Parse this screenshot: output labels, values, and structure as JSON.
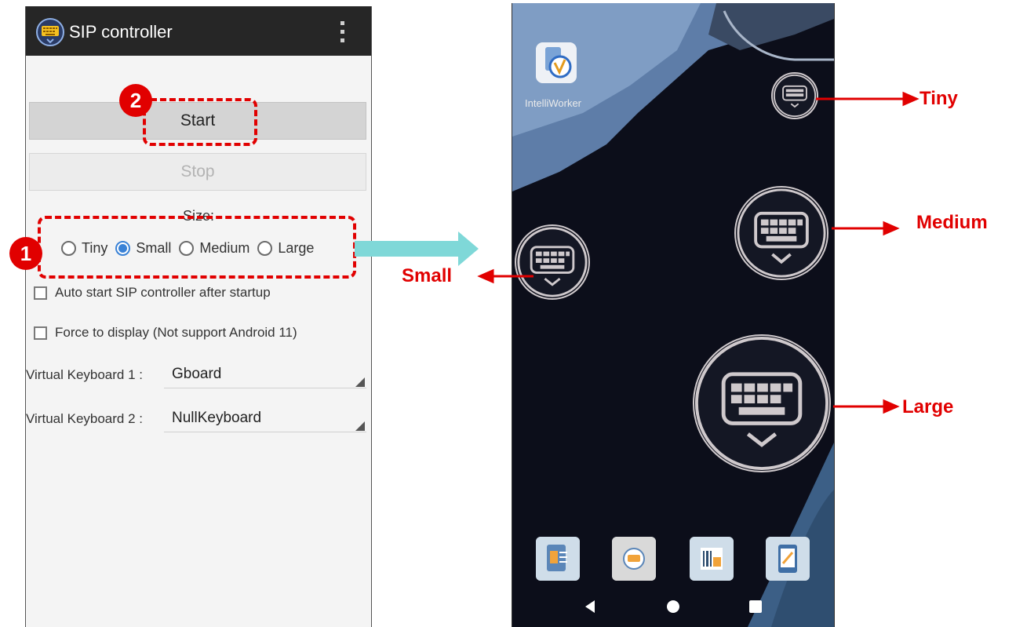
{
  "app": {
    "title": "SIP controller"
  },
  "buttons": {
    "start": "Start",
    "stop": "Stop"
  },
  "size": {
    "label": "Size:",
    "options": [
      "Tiny",
      "Small",
      "Medium",
      "Large"
    ],
    "selected": "Small"
  },
  "checkboxes": {
    "auto_start": {
      "label": "Auto start SIP controller after startup",
      "checked": false
    },
    "force_display": {
      "label": "Force to display (Not support Android 11)",
      "checked": false
    }
  },
  "keyboards": [
    {
      "label": "Virtual Keyboard 1 :",
      "value": "Gboard"
    },
    {
      "label": "Virtual Keyboard 2 :",
      "value": "NullKeyboard"
    }
  ],
  "markers": {
    "one": "1",
    "two": "2"
  },
  "home": {
    "app_label": "IntelliWorker",
    "size_labels": {
      "tiny": "Tiny",
      "medium": "Medium",
      "small": "Small",
      "large": "Large"
    }
  },
  "colors": {
    "accent": "#e10000",
    "radio": "#3a82d6",
    "arrow": "#7fd8d8"
  },
  "icons": [
    "keyboard-icon",
    "more-vert-icon",
    "back-icon",
    "home-icon",
    "recents-icon"
  ]
}
